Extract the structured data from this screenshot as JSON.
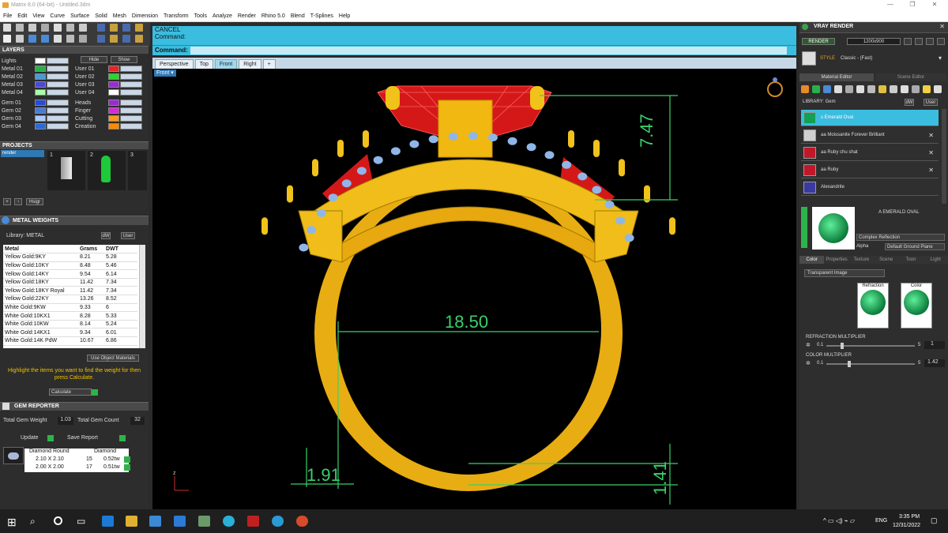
{
  "window": {
    "title": "Matrix 8.0 (64-bit) - Untitled.3dm",
    "min": "—",
    "max": "❐",
    "close": "✕"
  },
  "menu": [
    "File",
    "Edit",
    "View",
    "Curve",
    "Surface",
    "Solid",
    "Mesh",
    "Dimension",
    "Transform",
    "Tools",
    "Analyze",
    "Render",
    "Rhino 5.0",
    "Blend",
    "T-Splines",
    "Help"
  ],
  "layers": {
    "title": "LAYERS",
    "left": [
      "Lights",
      "Metal 01",
      "Metal 02",
      "Metal 03",
      "Metal 04"
    ],
    "right_buttons": [
      "Hide",
      "Show"
    ],
    "users": [
      "User 01",
      "User 02",
      "User 03",
      "User 04"
    ],
    "gems": [
      "Gem 01",
      "Gem 02",
      "Gem 03",
      "Gem 04"
    ],
    "extra": [
      "Heads",
      "Finger",
      "Cutting",
      "Creation"
    ],
    "user_colors": [
      "#e82424",
      "#2ad62a",
      "#9a2ad6",
      "#ffffff"
    ],
    "extra_colors": [
      "#9a2ad6",
      "#d62ad6",
      "#ff9a1a",
      "#ff8a00"
    ],
    "metal_colors": [
      "#ffffff",
      "#2ab04a",
      "#4a9ad6",
      "#4a4ad6",
      "#aaffaa"
    ],
    "gem_colors": [
      "#2a4ad6",
      "#4a7ad6",
      "#aaccff",
      "#2a6ad6"
    ]
  },
  "projects": {
    "title": "PROJECTS",
    "item": "render",
    "nums": [
      "1",
      "2",
      "3"
    ],
    "buttons": [
      "Hsigr"
    ]
  },
  "metal_weights": {
    "title": "METAL WEIGHTS",
    "library_label": "Library: METAL",
    "dw": "dW",
    "user": "User",
    "headers": [
      "Metal",
      "Grams",
      "DWT"
    ],
    "rows": [
      [
        "Yellow Gold:9KY",
        "8.21",
        "5.28"
      ],
      [
        "Yellow Gold:10KY",
        "8.48",
        "5.46"
      ],
      [
        "Yellow Gold:14KY",
        "9.54",
        "6.14"
      ],
      [
        "Yellow Gold:18KY",
        "11.42",
        "7.34"
      ],
      [
        "Yellow Gold:18KY Royal",
        "11.42",
        "7.34"
      ],
      [
        "Yellow Gold:22KY",
        "13.26",
        "8.52"
      ],
      [
        "White Gold:9KW",
        "9.33",
        "6"
      ],
      [
        "White Gold:10KX1",
        "8.28",
        "5.33"
      ],
      [
        "White Gold:10KW",
        "8.14",
        "5.24"
      ],
      [
        "White Gold:14KX1",
        "9.34",
        "6.01"
      ],
      [
        "White Gold:14K PdW",
        "10.67",
        "6.86"
      ]
    ],
    "use_object_materials": "Use Object Materials",
    "hint": "Highlight the items you want to find the weight for then press Calculate.",
    "calculate": "Calculate"
  },
  "gem_reporter": {
    "title": "GEM REPORTER",
    "total_weight_label": "Total Gem Weight",
    "total_weight": "1.03",
    "total_count_label": "Total Gem Count",
    "total_count": "32",
    "update": "Update",
    "save_report": "Save Report",
    "headers": [
      "Diamond Round",
      "Diamond"
    ],
    "rows": [
      [
        "2.10 X 2.10",
        "15",
        "0.52tw"
      ],
      [
        "2.00 X 2.00",
        "17",
        "0.51tw"
      ]
    ]
  },
  "command": {
    "line1": "CANCEL",
    "line2": "Command:",
    "prompt": "Command:"
  },
  "view_tabs": [
    "Perspective",
    "Top",
    "Front",
    "Right",
    "+"
  ],
  "active_tab": "Front",
  "viewport": {
    "label": "Front",
    "dims": {
      "height": "7.47",
      "width": "18.50",
      "band": "1.91",
      "bottom": "1.41"
    },
    "axis": {
      "z": "z",
      "x": "x"
    }
  },
  "vray": {
    "title": "VRAY RENDER",
    "render": "RENDER",
    "resolution": "1200x900",
    "style_label": "STYLE",
    "style": "Classic - (Fast)",
    "tabs": [
      "Material Editor",
      "Scene Editor"
    ],
    "library": "LIBRARY: Gem",
    "dw": "dW",
    "user": "User",
    "items": [
      "s Emerald Oval",
      "aa Moissanite Forever Brilliant",
      "aa Ruby chu shat",
      "aa Ruby",
      "Alexandrite"
    ],
    "item_colors": [
      "#13a052",
      "#cfcfcf",
      "#c0182a",
      "#c0182a",
      "#3a3aa0"
    ],
    "preview_name": "A EMERALD OVAL",
    "reflection": "Complex Reflection",
    "alpha": "Alpha",
    "ground": "Default Ground Plane",
    "sub_tabs": [
      "Color",
      "Properties",
      "Texture",
      "Scene",
      "Toon",
      "Light"
    ],
    "transparent": "Transparent Image",
    "refraction": "Refraction",
    "color": "Color",
    "refr_mult_label": "REFRACTION MULTIPLIER",
    "refr_min": "0.1",
    "refr_max": "5",
    "refr_val": "1",
    "color_mult_label": "COLOR MULTIPLIER",
    "col_min": "0.1",
    "col_max": "5",
    "col_val": "1.42"
  },
  "taskbar": {
    "time": "3:35 PM",
    "date": "12/31/2022",
    "lang": "ENG"
  }
}
